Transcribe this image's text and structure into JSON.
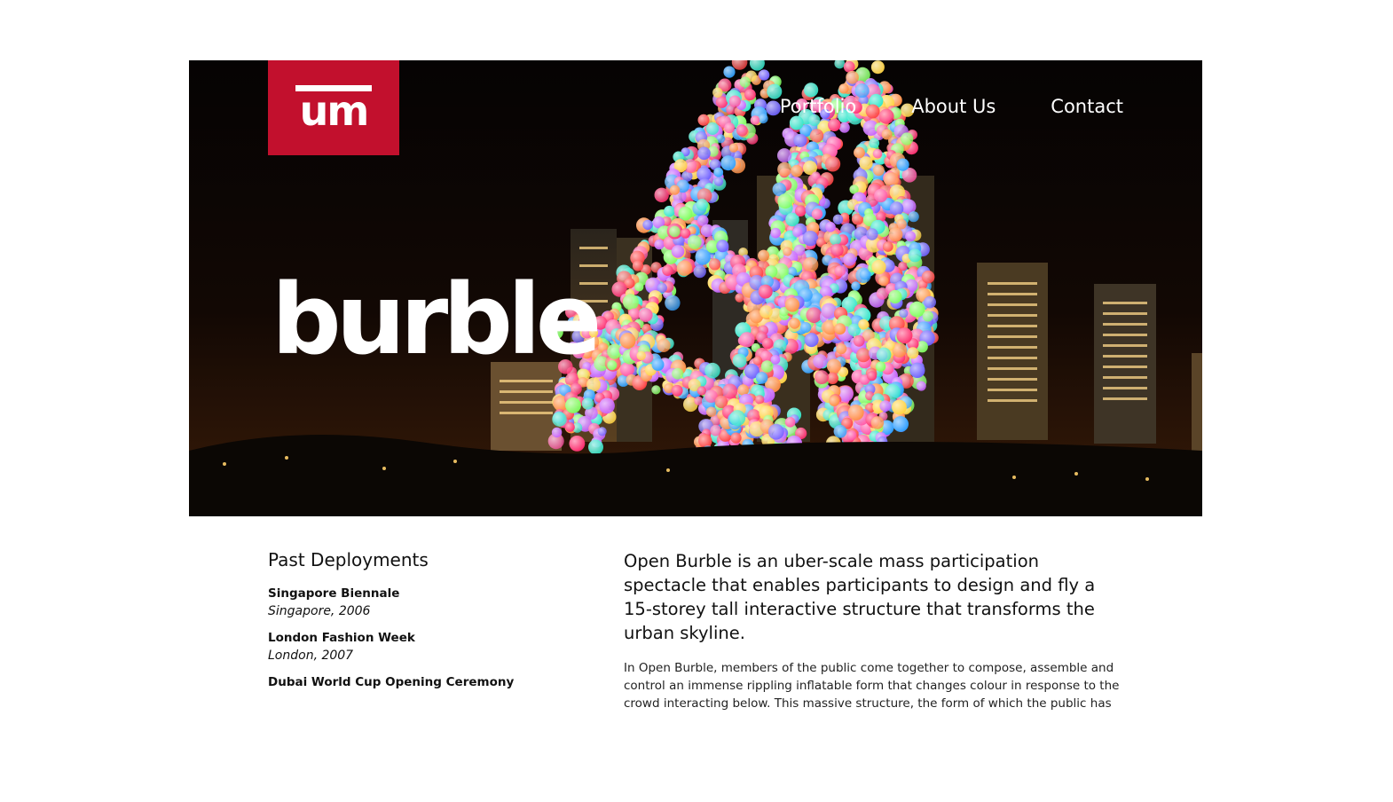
{
  "brand": {
    "logo_text": "um",
    "color": "#c2102d"
  },
  "nav": {
    "items": [
      {
        "label": "Portfolio"
      },
      {
        "label": "About Us"
      },
      {
        "label": "Contact"
      }
    ]
  },
  "hero": {
    "title": "burble",
    "image": "night-skyline-with-rainbow-balloon-structure"
  },
  "deployments": {
    "heading": "Past Deployments",
    "items": [
      {
        "name": "Singapore Biennale",
        "place": "Singapore, 2006"
      },
      {
        "name": "London Fashion Week",
        "place": "London, 2007"
      },
      {
        "name": "Dubai World Cup Opening Ceremony",
        "place": ""
      }
    ]
  },
  "description": {
    "lead": "Open Burble is an uber-scale mass participation spectacle that enables participants to design and fly a 15-storey tall interactive structure that transforms the urban skyline.",
    "body": "In Open Burble, members of the public come together to compose, assemble and control an immense rippling inflatable form that changes colour in response to the crowd interacting below. This massive structure, the form of which the public has"
  }
}
